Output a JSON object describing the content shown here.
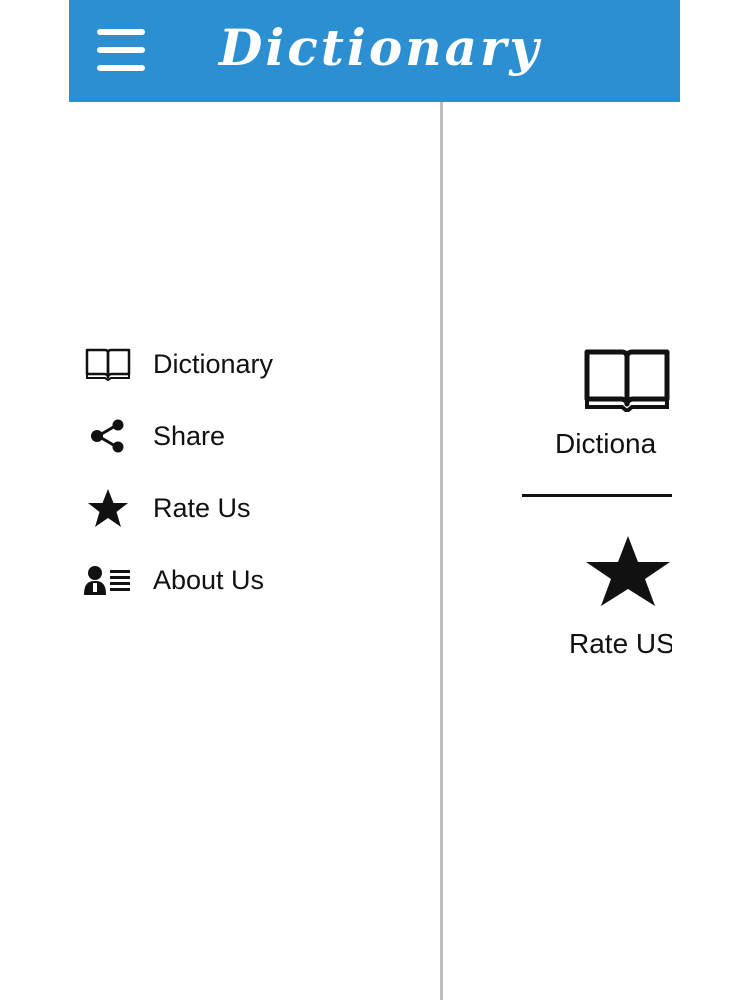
{
  "app_bar": {
    "title": "Dictionary",
    "menu_icon": "hamburger-menu-icon",
    "background_color": "#2b8fd1"
  },
  "drawer": {
    "items": [
      {
        "label": "Dictionary",
        "icon": "book-icon"
      },
      {
        "label": "Share",
        "icon": "share-icon"
      },
      {
        "label": "Rate Us",
        "icon": "star-icon"
      },
      {
        "label": "About Us",
        "icon": "about-us-icon"
      }
    ]
  },
  "main": {
    "cards": [
      {
        "label": "Dictiona",
        "icon": "book-icon"
      },
      {
        "label": "Rate US",
        "icon": "star-icon"
      }
    ]
  }
}
